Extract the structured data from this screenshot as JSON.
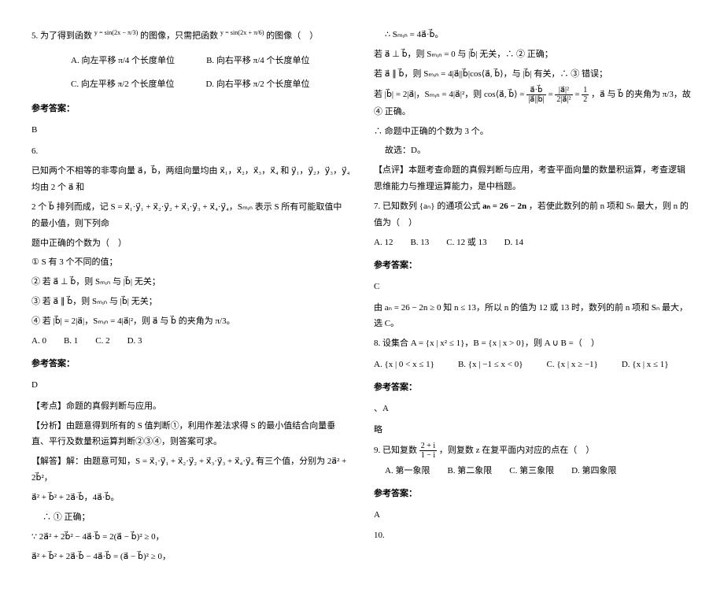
{
  "col1": {
    "q5_stem_a": "5. 为了得到函数",
    "q5_fn1": "y = sin(2x − π/3)",
    "q5_stem_b": "的图像，只需把函数",
    "q5_fn2": "y = sin(2x + π/6)",
    "q5_stem_c": "的图像（　）",
    "q5_opts": {
      "A": "A. 向左平移 π/4 个长度单位",
      "B": "B. 向右平移 π/4 个长度单位",
      "C": "C. 向左平移 π/2 个长度单位",
      "D": "D. 向右平移 π/2 个长度单位"
    },
    "q5_ans_lbl": "参考答案：",
    "q5_ans": "B",
    "q6_num": "6.",
    "q6_p1": "已知两个不相等的非零向量 a⃗，b⃗，两组向量均由 x⃗₁，x⃗₂，x⃗₃，x⃗₄ 和 y⃗₁，y⃗₂，y⃗₃，y⃗₄ 均由 2 个 a⃗ 和",
    "q6_p2": "2 个 b⃗ 排列而成，记 S = x⃗₁·y⃗₁ + x⃗₂·y⃗₂ + x⃗₃·y⃗₃ + x⃗₄·y⃗₄，Sₘᵢₙ 表示 S 所有可能取值中的最小值，则下列命",
    "q6_p3": "题中正确的个数为（　）",
    "q6_s1": "① S 有 3 个不同的值；",
    "q6_s2": "② 若 a⃗ ⊥ b⃗，则 Sₘᵢₙ 与 |b⃗| 无关；",
    "q6_s3": "③ 若 a⃗ ∥ b⃗，则 Sₘᵢₙ 与 |b⃗| 无关；",
    "q6_s4": "④ 若 |b⃗| = 2|a⃗|，Sₘᵢₙ = 4|a⃗|²，则 a⃗ 与 b⃗ 的夹角为 π/3。",
    "q6_opts": "A. 0　　B. 1　　C. 2　　D. 3",
    "q6_ans_lbl": "参考答案：",
    "q6_ans": "D",
    "q6_kd": "【考点】命题的真假判断与应用。",
    "q6_fx": "【分析】由题意得到所有的 S 值判断①，利用作差法求得 S 的最小值结合向量垂直、平行及数量积运算判断②③④，则答案可求。",
    "q6_jd1": "【解答】解：由题意可知，S = x⃗₁·y⃗₁ + x⃗₂·y⃗₂ + x⃗₃·y⃗₃ + x⃗₄·y⃗₄ 有三个值，分别为 2a⃗² + 2b⃗²，",
    "q6_jd2": "a⃗² + b⃗² + 2a⃗·b⃗，4a⃗·b⃗。",
    "q6_jd3": "∴ ① 正确；",
    "q6_jd4": "∵ 2a⃗² + 2b⃗² − 4a⃗·b⃗ = 2(a⃗ − b⃗)² ≥ 0，",
    "q6_jd5": "a⃗² + b⃗² + 2a⃗·b⃗ − 4a⃗·b⃗ = (a⃗ − b⃗)² ≥ 0，"
  },
  "col2": {
    "c1": "∴ Sₘᵢₙ = 4a⃗·b⃗。",
    "c2": "若 a⃗ ⊥ b⃗，则 Sₘᵢₙ = 0 与 |b⃗| 无关，∴ ② 正确；",
    "c3": "若 a⃗ ∥ b⃗，则 Sₘᵢₙ = 4|a⃗||b⃗|cos⟨a⃗, b⃗⟩，与 |b⃗| 有关，∴ ③ 错误；",
    "c4a": "若 |b⃗| = 2|a⃗|，Sₘᵢₙ = 4|a⃗|²，则 cos⟨a⃗, b⃗⟩ = ",
    "c4b": " ，a⃗ 与 b⃗ 的夹角为 π/3，故 ④ 正确。",
    "c5": "∴ 命题中正确的个数为 3 个。",
    "c6": "故选：D。",
    "c7": "【点评】本题考查命题的真假判断与应用，考查平面向量的数量积运算，考查逻辑思维能力与推理运算能力，是中档题。",
    "q7_stem_a": "7. 已知数列 {aₙ} 的通项公式 ",
    "q7_fn": "aₙ = 26 − 2n",
    "q7_stem_b": "，若使此数列的前 n 项和 Sₙ 最大，则 n 的值为（　）",
    "q7_opts": "A. 12　　B. 13　　C. 12 或 13　　D. 14",
    "q7_ans_lbl": "参考答案：",
    "q7_ans": "C",
    "q7_sol": "由 aₙ = 26 − 2n ≥ 0 知 n ≤ 13，所以 n 的值为 12 或 13 时，数列的前 n 项和 Sₙ 最大，选 C。",
    "q8_stem": "8. 设集合 A = {x | x² ≤ 1}，B = {x | x > 0}，则 A ∪ B =（　）",
    "q8_opts": {
      "A": "A. {x | 0 < x ≤ 1}",
      "B": "B. {x | −1 ≤ x < 0}",
      "C": "C. {x | x ≥ −1}",
      "D": "D. {x | x ≤ 1}"
    },
    "q8_ans_lbl": "参考答案：",
    "q8_ans": "、A",
    "q8_sol": "略",
    "q9_stem_a": "9. 已知复数 ",
    "q9_fn": "z = (2 + i) / (1 − i)",
    "q9_stem_b": "，则复数 z 在复平面内对应的点在（　）",
    "q9_opts": "A. 第一象限　　B. 第二象限　　C. 第三象限　　D. 第四象限",
    "q9_ans_lbl": "参考答案：",
    "q9_ans": "A",
    "q10": "10."
  }
}
